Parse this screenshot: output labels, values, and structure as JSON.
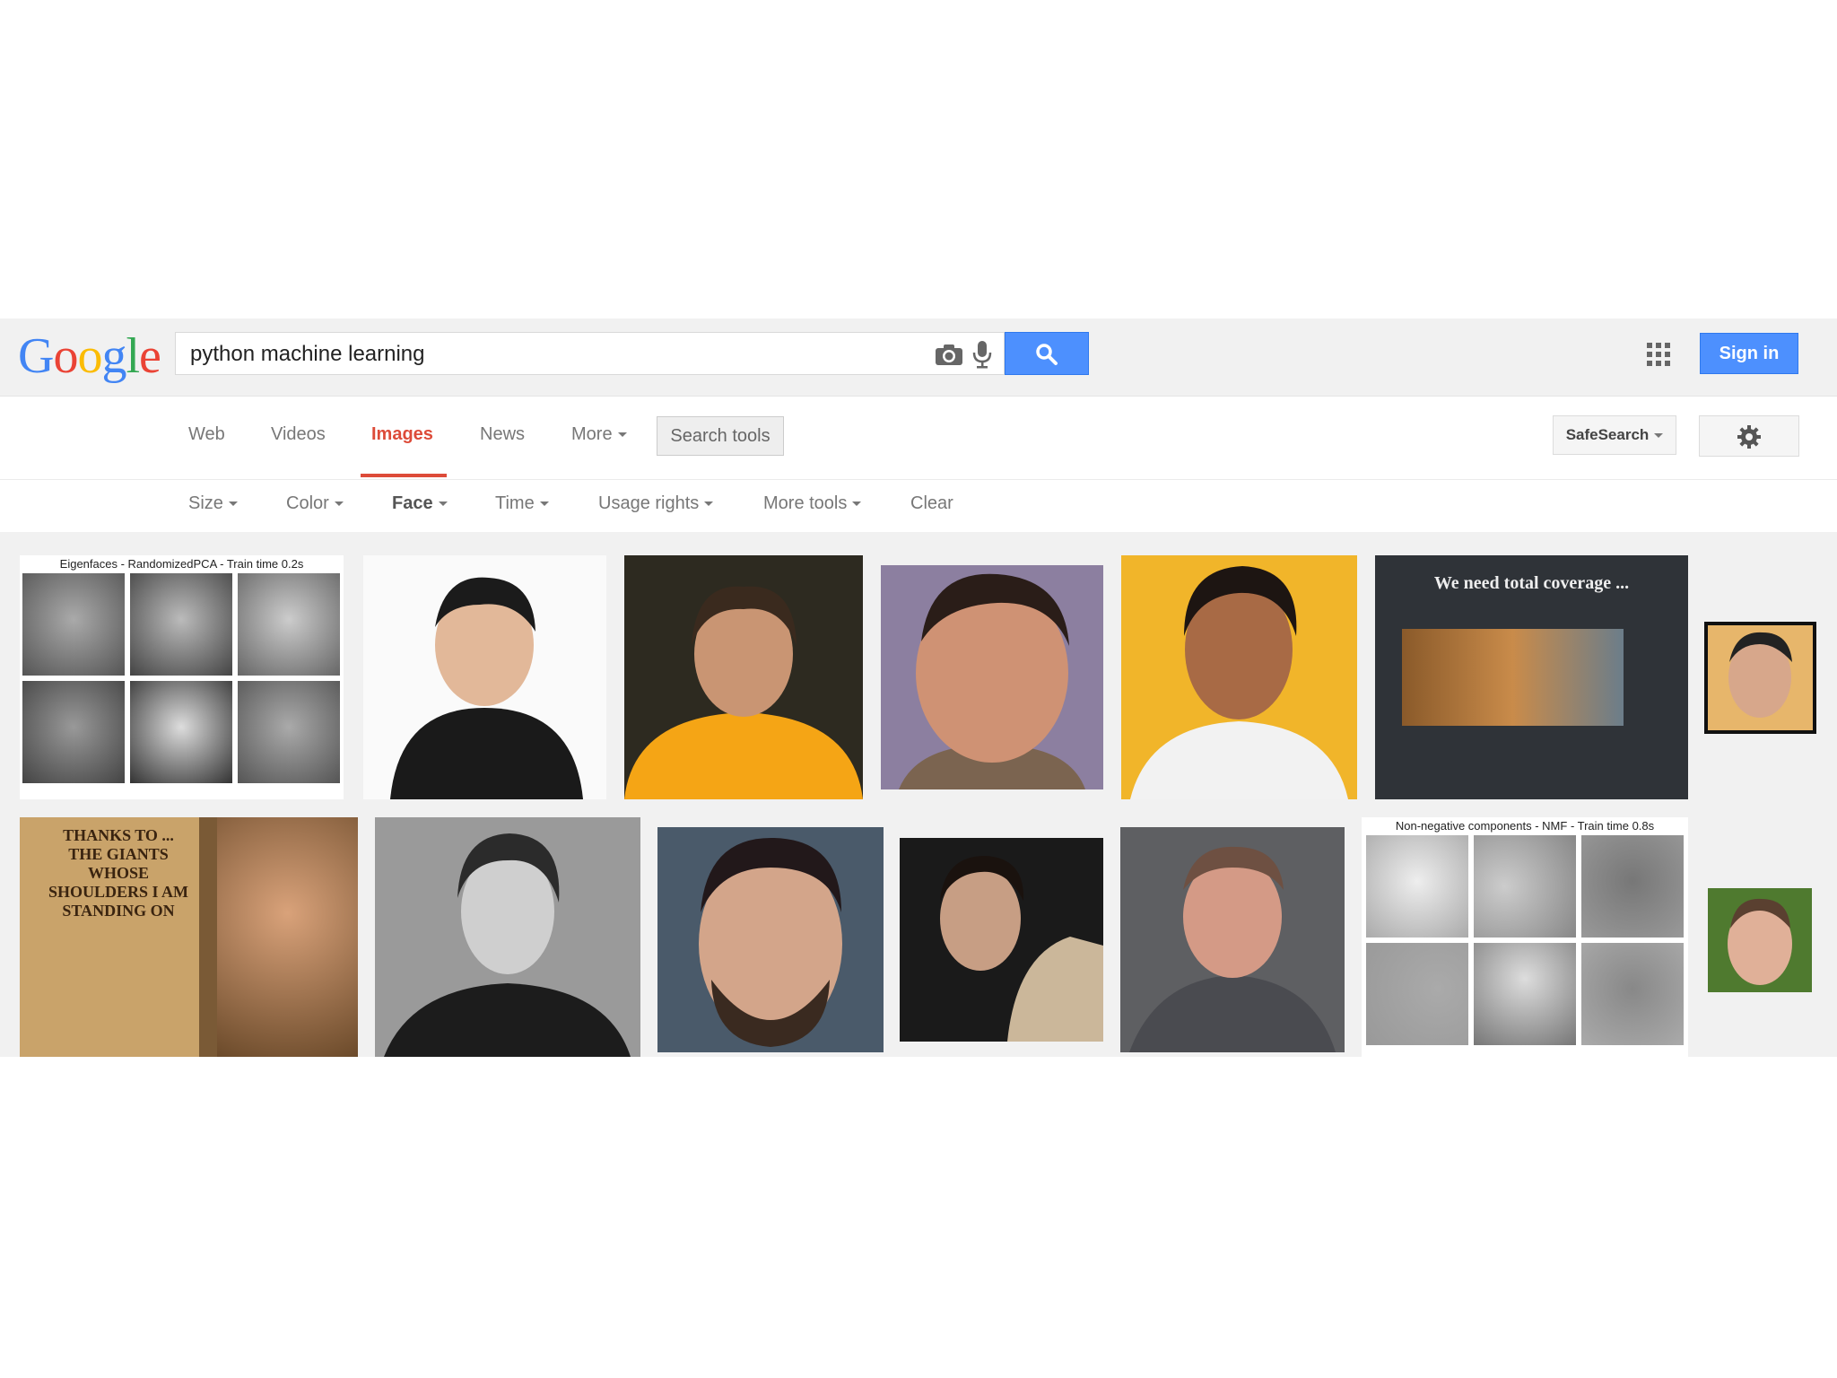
{
  "logo": {
    "letters": [
      "G",
      "o",
      "o",
      "g",
      "l",
      "e"
    ],
    "colors": [
      "#4285f4",
      "#ea4335",
      "#fbbc05",
      "#4285f4",
      "#34a853",
      "#ea4335"
    ]
  },
  "search": {
    "value": "python machine learning",
    "camera_icon": "camera-icon",
    "mic_icon": "microphone-icon",
    "button_icon": "magnifier-icon"
  },
  "header": {
    "apps_icon": "apps-grid-icon",
    "signin_label": "Sign in"
  },
  "nav": {
    "tabs": [
      {
        "label": "Web",
        "active": false
      },
      {
        "label": "Videos",
        "active": false
      },
      {
        "label": "Images",
        "active": true
      },
      {
        "label": "News",
        "active": false
      },
      {
        "label": "More",
        "active": false,
        "dropdown": true
      }
    ],
    "search_tools_label": "Search tools",
    "safesearch_label": "SafeSearch",
    "settings_icon": "gear-icon"
  },
  "tools": [
    {
      "label": "Size",
      "dropdown": true,
      "bold": false
    },
    {
      "label": "Color",
      "dropdown": true,
      "bold": false
    },
    {
      "label": "Face",
      "dropdown": true,
      "bold": true
    },
    {
      "label": "Time",
      "dropdown": true,
      "bold": false
    },
    {
      "label": "Usage rights",
      "dropdown": true,
      "bold": false
    },
    {
      "label": "More tools",
      "dropdown": true,
      "bold": false
    },
    {
      "label": "Clear",
      "dropdown": false,
      "bold": false
    }
  ],
  "results": {
    "eigenfaces_caption": "Eigenfaces - RandomizedPCA - Train time 0.2s",
    "coverage_caption": "We need total coverage ...",
    "nmf_caption": "Non-negative components - NMF - Train time 0.8s",
    "giants_text": "THANKS TO ... THE GIANTS WHOSE SHOULDERS I AM STANDING ON",
    "colors": {
      "yellow_bg": "#f1b52a",
      "orange_shirt": "#f5a515",
      "accent_red": "#dd4b39",
      "button_blue": "#4d90fe"
    }
  }
}
